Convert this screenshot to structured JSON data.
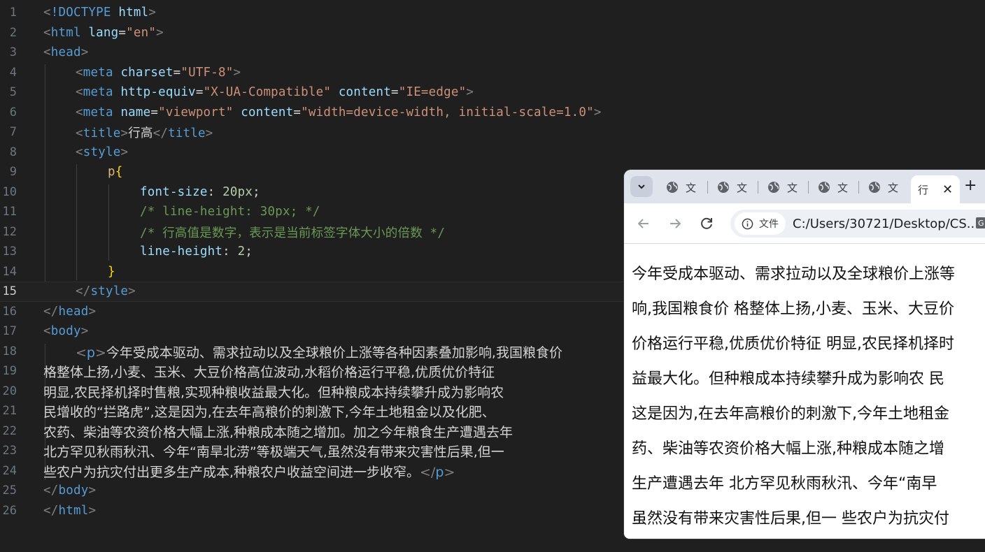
{
  "editor": {
    "line_numbers": [
      "1",
      "2",
      "3",
      "4",
      "5",
      "6",
      "7",
      "8",
      "9",
      "10",
      "11",
      "12",
      "13",
      "14",
      "15",
      "16",
      "17",
      "18",
      "19",
      "20",
      "21",
      "22",
      "23",
      "24",
      "25",
      "26"
    ],
    "current_line": "15",
    "tokens": {
      "l1": [
        "<",
        "!DOCTYPE",
        " html",
        ">"
      ],
      "l2": [
        "<",
        "html",
        " lang",
        "=",
        "\"en\"",
        ">"
      ],
      "l3": [
        "<",
        "head",
        ">"
      ],
      "l4": [
        "<",
        "meta",
        " charset",
        "=",
        "\"UTF-8\"",
        ">"
      ],
      "l5": [
        "<",
        "meta",
        " http-equiv",
        "=",
        "\"X-UA-Compatible\"",
        " content",
        "=",
        "\"IE=edge\"",
        ">"
      ],
      "l6": [
        "<",
        "meta",
        " name",
        "=",
        "\"viewport\"",
        " content",
        "=",
        "\"width=device-width, initial-scale=1.0\"",
        ">"
      ],
      "l7": [
        "<",
        "title",
        ">",
        "行高",
        "</",
        "title",
        ">"
      ],
      "l8": [
        "<",
        "style",
        ">"
      ],
      "l9": [
        "p",
        "{"
      ],
      "l10": [
        "font-size",
        ": ",
        "20px",
        ";"
      ],
      "l11": [
        "/* line-height: 30px; */"
      ],
      "l12": [
        "/* 行高值是数字，表示是当前标签字体大小的倍数 */"
      ],
      "l13": [
        "line-height",
        ": ",
        "2",
        ";"
      ],
      "l14": [
        "}"
      ],
      "l15": [
        "</",
        "style",
        ">"
      ],
      "l16": [
        "</",
        "head",
        ">"
      ],
      "l17": [
        "<",
        "body",
        ">"
      ],
      "l18": [
        "<",
        "p",
        ">",
        "今年受成本驱动、需求拉动以及全球粮价上涨等各种因素叠加影响,我国粮食价"
      ],
      "l19": [
        "格整体上扬,小麦、玉米、大豆价格高位波动,水稻价格运行平稳,优质优价特征"
      ],
      "l20": [
        "明显,农民择机择时售粮,实现种粮收益最大化。但种粮成本持续攀升成为影响农"
      ],
      "l21": [
        "民增收的“拦路虎”,这是因为,在去年高粮价的刺激下,今年土地租金以及化肥、"
      ],
      "l22": [
        "农药、柴油等农资价格大幅上涨,种粮成本随之增加。加之今年粮食生产遭遇去年"
      ],
      "l23": [
        "北方罕见秋雨秋汛、今年“南旱北涝”等极端天气,虽然没有带来灾害性后果,但一"
      ],
      "l24": [
        "些农户为抗灾付出更多生产成本,种粮农户收益空间进一步收窄。",
        "</",
        "p",
        ">"
      ],
      "l25": [
        "</",
        "body",
        ">"
      ],
      "l26": [
        "</",
        "html",
        ">"
      ]
    }
  },
  "browser": {
    "tabs": [
      "文",
      "文",
      "文",
      "文",
      "文"
    ],
    "active_tab": "行",
    "close_glyph": "✕",
    "new_tab_glyph": "+",
    "chip_label": "文件",
    "url": "C:/Users/30721/Desktop/CS...",
    "paragraph_lines": [
      "今年受成本驱动、需求拉动以及全球粮价上涨等",
      "响,我国粮食价 格整体上扬,小麦、玉米、大豆价",
      "价格运行平稳,优质优价特征 明显,农民择机择时",
      "益最大化。但种粮成本持续攀升成为影响农 民",
      "这是因为,在去年高粮价的刺激下,今年土地租金",
      "药、柴油等农资价格大幅上涨,种粮成本随之增",
      "生产遭遇去年 北方罕见秋雨秋汛、今年“南早",
      "虽然没有带来灾害性后果,但一 些农户为抗灾付"
    ]
  },
  "colors": {
    "editor_bg": "#1f1f1f",
    "tag": "#569cd6",
    "attr": "#9cdcfe",
    "string": "#ce9178",
    "comment": "#6a9955",
    "selector": "#d7ba7d",
    "brace": "#ffd700",
    "number": "#b5cea8"
  },
  "icons": [
    "tab-search-icon",
    "globe-icon",
    "close-icon",
    "back-icon",
    "forward-icon",
    "reload-icon",
    "info-icon",
    "translate-icon"
  ]
}
